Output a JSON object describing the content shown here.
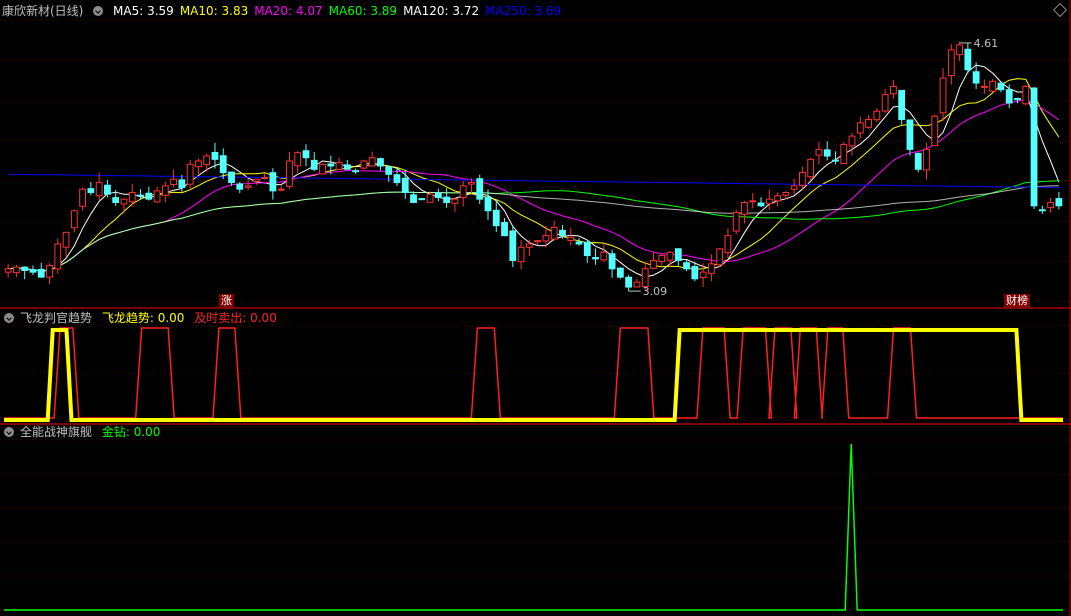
{
  "main": {
    "title": "康欣新材(日线)",
    "ma_labels": [
      {
        "text": "MA5: 3.59",
        "color": "#ffffff"
      },
      {
        "text": "MA10: 3.83",
        "color": "#ffff00"
      },
      {
        "text": "MA20: 4.07",
        "color": "#ff00ff"
      },
      {
        "text": "MA60: 3.89",
        "color": "#00ff00"
      },
      {
        "text": "MA120: 3.72",
        "color": "#ffffff"
      },
      {
        "text": "MA250: 3.69",
        "color": "#0000ff"
      }
    ],
    "high_label": "4.61",
    "low_label": "3.09",
    "badge_zhang": "涨",
    "badge_bang": "财榜"
  },
  "panel2": {
    "title": "飞龙判官趋势",
    "label_trend": "飞龙趋势: 0.00",
    "label_sell": "及时卖出: 0.00"
  },
  "panel3": {
    "title": "全能战神旗舰",
    "label_gold": "金钻: 0.00"
  },
  "chart_data": [
    {
      "type": "candlestick",
      "title": "康欣新材(日线)",
      "ylim": [
        3.0,
        4.7
      ],
      "candle_count": 128,
      "colors": {
        "up": "#ff3232",
        "down": "#54ffff",
        "ma5": "#ffffff",
        "ma10": "#ffff00",
        "ma20": "#ff00ff",
        "ma60": "#00ff00",
        "ma120": "#ffffff",
        "ma250": "#0000ff"
      },
      "closes": [
        3.2,
        3.21,
        3.19,
        3.18,
        3.15,
        3.22,
        3.35,
        3.42,
        3.55,
        3.68,
        3.66,
        3.72,
        3.65,
        3.6,
        3.62,
        3.66,
        3.64,
        3.62,
        3.67,
        3.7,
        3.74,
        3.69,
        3.83,
        3.85,
        3.88,
        3.86,
        3.78,
        3.72,
        3.68,
        3.7,
        3.74,
        3.75,
        3.67,
        3.68,
        3.85,
        3.9,
        3.87,
        3.8,
        3.83,
        3.82,
        3.84,
        3.8,
        3.79,
        3.85,
        3.87,
        3.82,
        3.77,
        3.72,
        3.66,
        3.6,
        3.62,
        3.65,
        3.63,
        3.6,
        3.62,
        3.7,
        3.72,
        3.62,
        3.55,
        3.46,
        3.4,
        3.25,
        3.33,
        3.35,
        3.37,
        3.4,
        3.45,
        3.4,
        3.39,
        3.35,
        3.28,
        3.26,
        3.3,
        3.2,
        3.15,
        3.09,
        3.12,
        3.2,
        3.25,
        3.28,
        3.3,
        3.25,
        3.2,
        3.14,
        3.18,
        3.23,
        3.32,
        3.4,
        3.54,
        3.6,
        3.61,
        3.58,
        3.62,
        3.64,
        3.66,
        3.7,
        3.78,
        3.86,
        3.92,
        3.88,
        3.85,
        3.95,
        4.0,
        4.08,
        4.1,
        4.15,
        4.25,
        4.3,
        4.1,
        3.92,
        3.8,
        3.92,
        4.12,
        4.35,
        4.52,
        4.55,
        4.4,
        4.32,
        4.3,
        4.33,
        4.28,
        4.2,
        4.22,
        4.3,
        3.58,
        3.55,
        3.6,
        3.58
      ],
      "ma_latest": {
        "MA5": 3.59,
        "MA10": 3.83,
        "MA20": 4.07,
        "MA60": 3.89,
        "MA120": 3.72,
        "MA250": 3.69
      },
      "annotations": [
        {
          "text": "4.61",
          "value": 4.61
        },
        {
          "text": "3.09",
          "value": 3.09
        }
      ]
    },
    {
      "type": "line",
      "title": "飞龙判官趋势",
      "ylim": [
        0,
        1
      ],
      "series": [
        {
          "name": "飞龙趋势",
          "color": "#ffff00",
          "segments": [
            [
              0.046,
              0.059
            ],
            [
              0.638,
              0.956
            ]
          ]
        },
        {
          "name": "及时卖出",
          "color": "#ff2020",
          "segments": [
            [
              0.053,
              0.065
            ],
            [
              0.13,
              0.155
            ],
            [
              0.203,
              0.218
            ],
            [
              0.447,
              0.463
            ],
            [
              0.582,
              0.608
            ],
            [
              0.66,
              0.68
            ],
            [
              0.698,
              0.719
            ],
            [
              0.728,
              0.743
            ],
            [
              0.752,
              0.767
            ],
            [
              0.778,
              0.792
            ],
            [
              0.84,
              0.856
            ]
          ]
        }
      ]
    },
    {
      "type": "line",
      "title": "全能战神旗舰",
      "ylim": [
        0,
        1
      ],
      "series": [
        {
          "name": "金钻",
          "color": "#00ff00",
          "spikes": [
            0.8
          ]
        }
      ]
    }
  ]
}
